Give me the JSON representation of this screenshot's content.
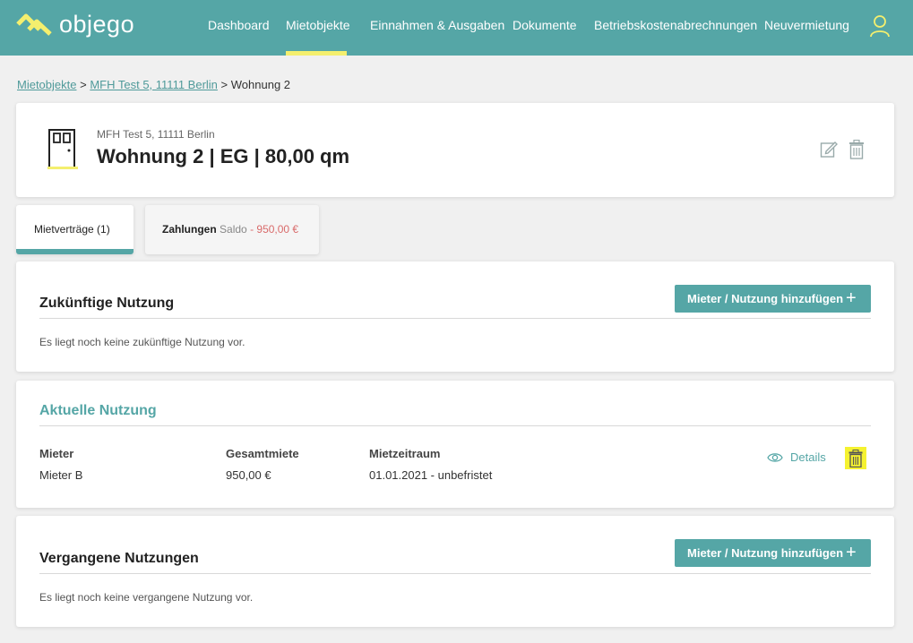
{
  "app": {
    "logo_text": "objego",
    "brand_color": "#55a6a6",
    "accent_color": "#f4ef6e"
  },
  "nav": {
    "items": [
      {
        "label": "Dashboard"
      },
      {
        "label": "Mietobjekte",
        "active": true
      },
      {
        "label": "Einnahmen & Ausgaben"
      },
      {
        "label": "Dokumente"
      },
      {
        "label": "Betriebskostenabrechnungen"
      },
      {
        "label": "Neuvermietung"
      }
    ],
    "user_icon": "user-icon"
  },
  "breadcrumb": {
    "items": [
      "Mietobjekte",
      "MFH Test 5, 11111 Berlin",
      "Wohnung 2"
    ],
    "separator": ">"
  },
  "unit": {
    "address": "MFH Test 5, 11111 Berlin",
    "title": "Wohnung 2 | EG | 80,00 qm",
    "icons": [
      "door-icon",
      "edit-icon",
      "trash-icon"
    ]
  },
  "tabs": {
    "contracts_label": "Mietverträge (1)",
    "payments_label": "Zahlungen",
    "saldo_label": "Saldo",
    "saldo_amount": "- 950,00 €"
  },
  "future": {
    "title": "Zukünftige Nutzung",
    "add_button": "Mieter / Nutzung hinzufügen",
    "empty_text": "Es liegt noch keine zukünftige Nutzung vor."
  },
  "current": {
    "title": "Aktuelle Nutzung",
    "columns": [
      "Mieter",
      "Gesamtmiete",
      "Mietzeitraum"
    ],
    "row": {
      "tenant": "Mieter B",
      "rent": "950,00 €",
      "period": "01.01.2021 - unbefristet"
    },
    "details_label": "Details"
  },
  "past": {
    "title": "Vergangene Nutzungen",
    "add_button": "Mieter / Nutzung hinzufügen",
    "empty_text": "Es liegt noch keine vergangene Nutzung vor."
  }
}
